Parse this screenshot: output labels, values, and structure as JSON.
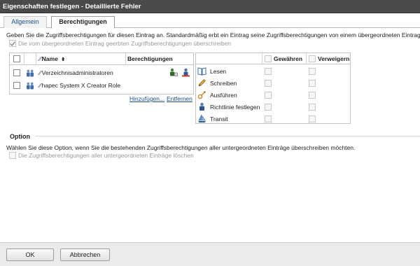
{
  "window": {
    "title": "Eigenschaften festlegen - Detaillierte Fehler"
  },
  "tabs": [
    {
      "label": "Allgemein",
      "active": false
    },
    {
      "label": "Berechtigungen",
      "active": true
    }
  ],
  "permissions": {
    "description": "Geben Sie die Zugriffsberechtigungen für diesen Eintrag an. Standardmäßig erbt ein Eintrag seine Zugriffsberechtigungen von einem übergeordneten Eintrag.",
    "override_label": "Die vom übergeordneten Eintrag geerbten Zugriffsberechtigungen überschreiben",
    "override_checked": true
  },
  "principals": {
    "headers": {
      "name": "Name",
      "permissions": "Berechtigungen"
    },
    "sort_icon": "sort-updown-icon",
    "rows": [
      {
        "name": "Verzeichnisadministratoren",
        "icon": "users-group-icon",
        "action_icons": [
          "edit-permissions-icon",
          "remove-user-icon"
        ]
      },
      {
        "name": "hapec System X Creator Role",
        "icon": "users-group-icon"
      }
    ],
    "add_link": "Hinzufügen...",
    "remove_link": "Entfernen"
  },
  "rights": {
    "headers": {
      "grant": "Gewähren",
      "deny": "Verweigern"
    },
    "rows": [
      {
        "label": "Lesen",
        "icon": "book-icon"
      },
      {
        "label": "Schreiben",
        "icon": "pencil-icon"
      },
      {
        "label": "Ausführen",
        "icon": "execute-icon"
      },
      {
        "label": "Richtlinie festlegen",
        "icon": "policy-user-icon"
      },
      {
        "label": "Transit",
        "icon": "transit-boat-icon"
      }
    ]
  },
  "option": {
    "title": "Option",
    "description": "Wählen Sie diese Option, wenn Sie die bestehenden Zugriffsberechtigungen aller untergeordneten Einträge überschreiben möchten.",
    "checkbox_label": "Die Zugriffsberechtigungen aller untergeordneten Einträge löschen"
  },
  "buttons": {
    "ok": "OK",
    "cancel": "Abbrechen"
  },
  "colors": {
    "titlebar": "#4a4a4a",
    "link": "#1a4f8a",
    "footer": "#ebebeb"
  }
}
